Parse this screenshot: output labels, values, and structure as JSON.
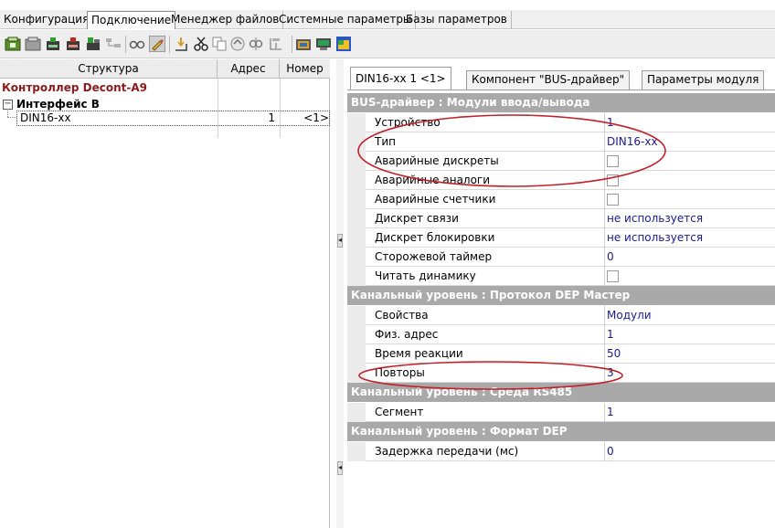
{
  "menu": {
    "tabs": [
      "Конфигурация",
      "Подключение",
      "Менеджер файлов",
      "Системные параметры",
      "Базы параметров"
    ],
    "active_index": 1
  },
  "toolbar": {
    "icons": [
      "add-module-icon",
      "module-icon",
      "add-device-icon",
      "remove-device-icon",
      "add-group-icon",
      "tree-icon",
      "glasses-icon",
      "edit-icon",
      "insert-icon",
      "cut-icon",
      "copy-icon",
      "paste-icon",
      "link-icon",
      "config-icon",
      "load-icon",
      "monitor-icon",
      "window-icon"
    ]
  },
  "tree": {
    "columns": [
      "Структура",
      "Адрес",
      "Номер"
    ],
    "root": "Контроллер Decont-A9",
    "interface": "Интерфейс B",
    "expand_symbol": "−",
    "device": {
      "name": "DIN16-xx",
      "address": "1",
      "number": "<1>"
    }
  },
  "splitter": {
    "arrow": "◂"
  },
  "tabs": [
    {
      "label": "DIN16-xx 1 <1>",
      "active": true
    },
    {
      "label": "Компонент \"BUS-драйвер\"",
      "active": false
    },
    {
      "label": "Параметры модуля",
      "active": false
    }
  ],
  "sections": [
    {
      "title": "BUS-драйвер : Модули ввода/вывода",
      "rows": [
        {
          "name": "Устройство",
          "value": "1"
        },
        {
          "name": "Тип",
          "value": "DIN16-xx"
        },
        {
          "name": "Аварийные дискреты",
          "checkbox": true
        },
        {
          "name": "Аварийные аналоги",
          "checkbox": true
        },
        {
          "name": "Аварийные счетчики",
          "checkbox": true
        },
        {
          "name": "Дискрет связи",
          "value": "не используется"
        },
        {
          "name": "Дискрет блокировки",
          "value": "не используется"
        },
        {
          "name": "Сторожевой таймер",
          "value": "0"
        },
        {
          "name": "Читать динамику",
          "checkbox": true
        }
      ]
    },
    {
      "title": "Канальный уровень : Протокол DEP Мастер",
      "rows": [
        {
          "name": "Свойства",
          "value": "Модули"
        },
        {
          "name": "Физ. адрес",
          "value": "1"
        },
        {
          "name": "Время реакции",
          "value": "50"
        },
        {
          "name": "Повторы",
          "value": "3"
        }
      ]
    },
    {
      "title": "Канальный уровень : Среда RS485",
      "rows": [
        {
          "name": "Сегмент",
          "value": "1"
        }
      ]
    },
    {
      "title": "Канальный уровень : Формат DEP",
      "rows": [
        {
          "name": "Задержка передачи (мс)",
          "value": "0"
        }
      ]
    }
  ],
  "colors": {
    "annotation": "#c0202a",
    "root_text": "#8b1a1a",
    "value_text": "#1a1a8c",
    "section_bg": "#a9a9a9"
  }
}
